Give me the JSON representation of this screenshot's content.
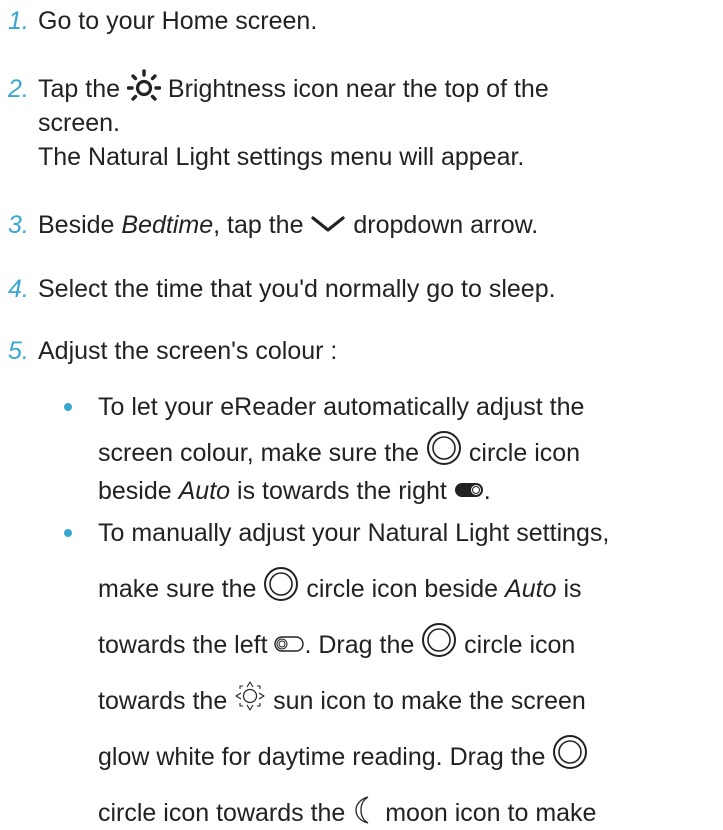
{
  "steps": [
    {
      "num": "1.",
      "text": "Go to your Home screen."
    },
    {
      "num": "2.",
      "pre": "Tap the",
      "post": "Brightness icon near the top of the",
      "line2": "screen.",
      "line3": "The Natural Light settings menu will appear.",
      "icon": "brightness-icon"
    },
    {
      "num": "3.",
      "pre": "Beside",
      "em": "Bedtime",
      "mid": ", tap the",
      "post": "dropdown arrow.",
      "icon": "chevron-down-icon"
    },
    {
      "num": "4.",
      "text": "Select the time that you'd normally go to sleep."
    },
    {
      "num": "5.",
      "text": "Adjust the screen's colour :"
    }
  ],
  "bullets": {
    "first": {
      "line1": "To let your eReader automatically adjust the",
      "line2_pre": "screen colour, make sure the",
      "line2_post": "circle icon",
      "line3_pre": "beside",
      "line3_em": "Auto",
      "line3_post": "is towards the right",
      "line3_end": "."
    },
    "second": {
      "line1": "To manually adjust your Natural Light settings,",
      "line2_pre": "make sure the",
      "line2_mid": "circle icon beside",
      "line2_em": "Auto",
      "line2_post": "is",
      "line3_pre": "towards the left",
      "line3_mid": ". Drag the",
      "line3_post": "circle icon",
      "line4_pre": "towards the",
      "line4_post": "sun icon to make the screen",
      "line5_pre": "glow white for daytime reading. Drag the",
      "line6_pre": "circle icon towards the",
      "line6_post": "moon icon to make"
    }
  },
  "colors": {
    "accent": "#3aa7d0",
    "text": "#222222"
  }
}
